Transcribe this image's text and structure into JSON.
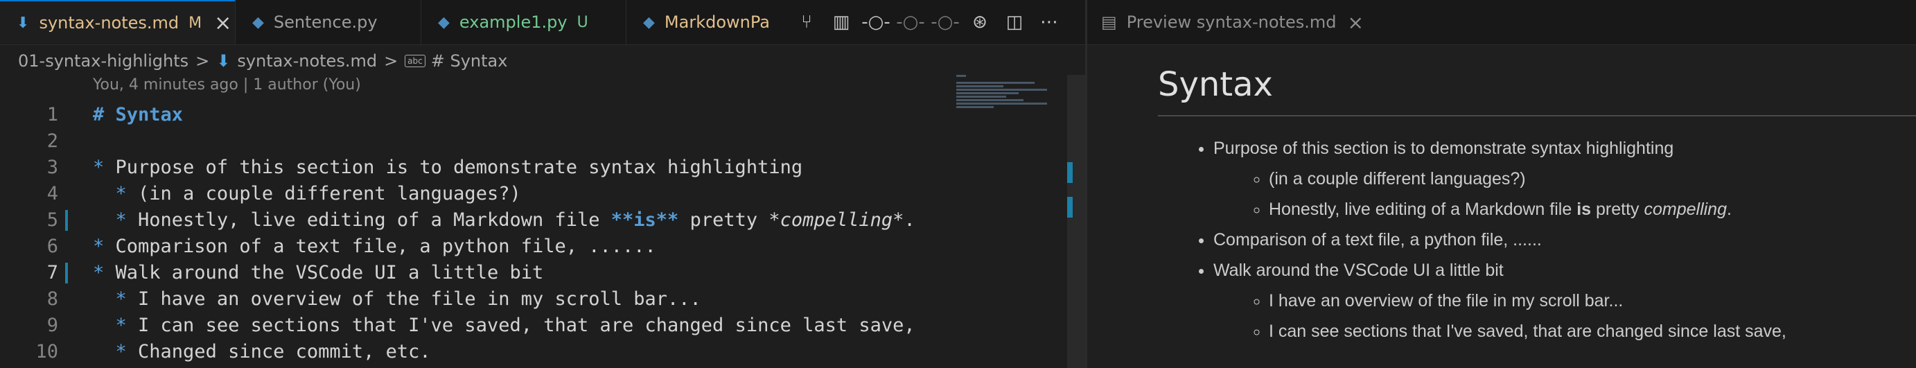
{
  "editor": {
    "tabs": [
      {
        "label": "syntax-notes.md",
        "badge": "M",
        "icon": "markdown-icon",
        "close": "×"
      },
      {
        "label": "Sentence.py",
        "badge": "",
        "icon": "python-icon"
      },
      {
        "label": "example1.py",
        "badge": "U",
        "icon": "python-icon"
      },
      {
        "label": "MarkdownPa",
        "badge": "",
        "icon": "python-icon"
      }
    ],
    "actions": [
      {
        "name": "source-control-icon",
        "glyph": "⌥"
      },
      {
        "name": "open-changes-icon",
        "glyph": "◫"
      },
      {
        "name": "git-commit-icon",
        "glyph": "⊸"
      },
      {
        "name": "previous-change-icon",
        "glyph": "⊸"
      },
      {
        "name": "next-change-icon",
        "glyph": "⊸"
      },
      {
        "name": "timeline-icon",
        "glyph": "⊛"
      },
      {
        "name": "split-editor-icon",
        "glyph": "◫"
      },
      {
        "name": "more-actions-icon",
        "glyph": "⋯"
      }
    ],
    "breadcrumb": {
      "folder": "01-syntax-highlights",
      "file": "syntax-notes.md",
      "symbol_icon_text": "abc",
      "symbol": "# Syntax",
      "sep": ">"
    },
    "blame": "You, 4 minutes ago | 1 author (You)",
    "lines": [
      {
        "num": "1",
        "segments": [
          {
            "t": "# Syntax",
            "c": "hd"
          }
        ]
      },
      {
        "num": "2",
        "segments": []
      },
      {
        "num": "3",
        "segments": [
          {
            "t": "* ",
            "c": "bullet"
          },
          {
            "t": "Purpose of this section is to demonstrate syntax highlighting",
            "c": ""
          }
        ]
      },
      {
        "num": "4",
        "segments": [
          {
            "t": "  * ",
            "c": "bullet"
          },
          {
            "t": "(in a couple different languages?)",
            "c": ""
          }
        ]
      },
      {
        "num": "5",
        "modified": true,
        "segments": [
          {
            "t": "  * ",
            "c": "bullet"
          },
          {
            "t": "Honestly, live editing of a Markdown file ",
            "c": ""
          },
          {
            "t": "**is**",
            "c": "bold"
          },
          {
            "t": " pretty ",
            "c": ""
          },
          {
            "t": "*compelling*",
            "c": "it"
          },
          {
            "t": ".",
            "c": ""
          }
        ]
      },
      {
        "num": "6",
        "segments": [
          {
            "t": "* ",
            "c": "bullet"
          },
          {
            "t": "Comparison of a text file, a python file, ......",
            "c": ""
          }
        ]
      },
      {
        "num": "7",
        "modified": true,
        "current": true,
        "segments": [
          {
            "t": "* ",
            "c": "bullet"
          },
          {
            "t": "Walk around the VSCode UI a little bit",
            "c": ""
          }
        ]
      },
      {
        "num": "8",
        "segments": [
          {
            "t": "  * ",
            "c": "bullet"
          },
          {
            "t": "I have an overview of the file in my scroll bar...",
            "c": ""
          }
        ]
      },
      {
        "num": "9",
        "segments": [
          {
            "t": "  * ",
            "c": "bullet"
          },
          {
            "t": "I can see sections that I've saved, that are changed since last save,",
            "c": ""
          }
        ]
      },
      {
        "num": "10",
        "segments": [
          {
            "t": "  * ",
            "c": "bullet"
          },
          {
            "t": "Changed since commit, etc.",
            "c": ""
          }
        ]
      }
    ]
  },
  "preview": {
    "tab_label": "Preview syntax-notes.md",
    "tab_close": "×",
    "heading": "Syntax",
    "items": {
      "i1": "Purpose of this section is to demonstrate syntax highlighting",
      "i1a": "(in a couple different languages?)",
      "i1b_pre": "Honestly, live editing of a Markdown file ",
      "i1b_bold": "is",
      "i1b_mid": " pretty ",
      "i1b_it": "compelling",
      "i1b_post": ".",
      "i2": "Comparison of a text file, a python file, ......",
      "i3": "Walk around the VSCode UI a little bit",
      "i3a": "I have an overview of the file in my scroll bar...",
      "i3b": "I can see sections that I've saved, that are changed since last save,"
    }
  },
  "colors": {
    "accent": "#0078d4",
    "modified_tab": "#e2c08d",
    "untracked": "#73c991",
    "markdown_token": "#569cd6",
    "gutter_modified": "#1b81a8"
  }
}
